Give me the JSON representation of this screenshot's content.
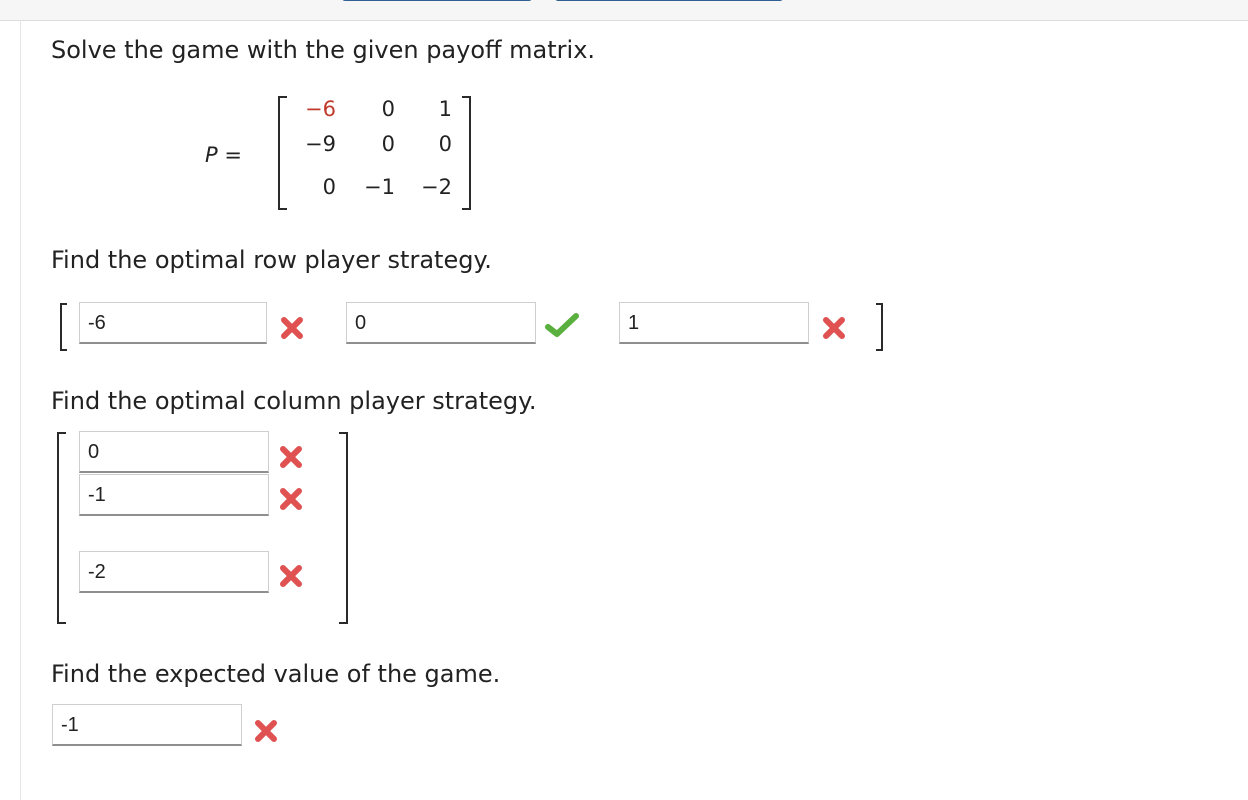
{
  "question": {
    "prompt": "Solve the game with the given payoff matrix.",
    "matrix_label": "P =",
    "matrix": [
      [
        "−6",
        "0",
        "1"
      ],
      [
        "−9",
        "0",
        "0"
      ],
      [
        "0",
        "−1",
        "−2"
      ]
    ]
  },
  "row_strategy": {
    "prompt": "Find the optimal row player strategy.",
    "answers": [
      {
        "value": "-6",
        "status": "incorrect"
      },
      {
        "value": "0",
        "status": "correct"
      },
      {
        "value": "1",
        "status": "incorrect"
      }
    ]
  },
  "column_strategy": {
    "prompt": "Find the optimal column player strategy.",
    "answers": [
      {
        "value": "0",
        "status": "incorrect"
      },
      {
        "value": "-1",
        "status": "incorrect"
      },
      {
        "value": "-2",
        "status": "incorrect"
      }
    ]
  },
  "expected_value": {
    "prompt": "Find the expected value of the game.",
    "answer": {
      "value": "-1",
      "status": "incorrect"
    }
  },
  "colors": {
    "incorrect": "#e05252",
    "correct": "#5ab03e",
    "highlight_entry": "#c0392b"
  }
}
